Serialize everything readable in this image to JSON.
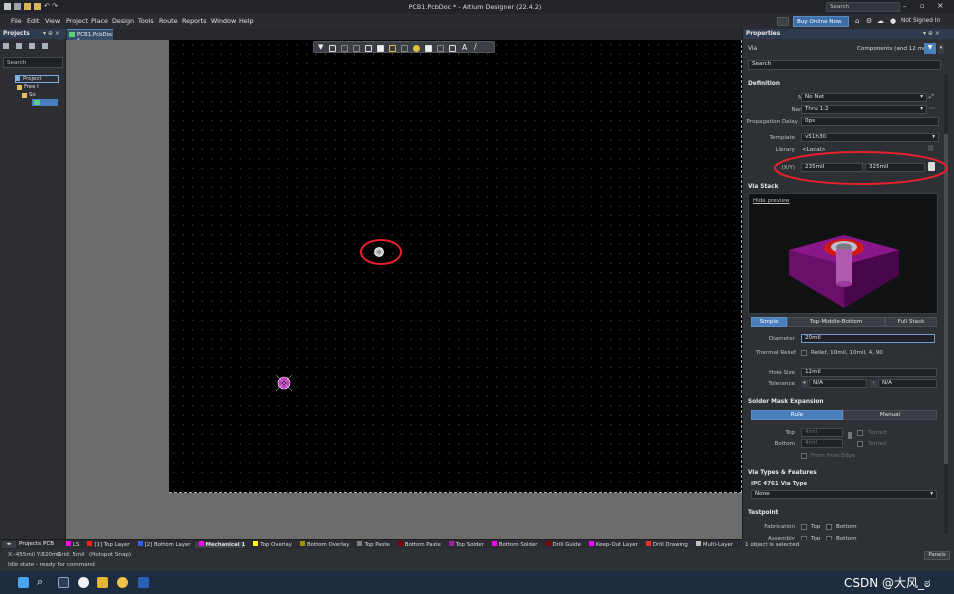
{
  "titlebar": {
    "title": "PCB1.PcbDoc * - Altium Designer (22.4.2)",
    "search_placeholder": "Search"
  },
  "menu": [
    "File",
    "Edit",
    "View",
    "Project",
    "Place",
    "Design",
    "Tools",
    "Route",
    "Reports",
    "Window",
    "Help"
  ],
  "toolbar_right": {
    "buy_label": "Buy Online Now",
    "signin_label": "Not Signed In"
  },
  "projects_panel": {
    "title": "Projects",
    "search_placeholder": "Search",
    "tree": [
      "Project",
      "Free I",
      "So"
    ]
  },
  "doc_tab": {
    "label": "PCB1.PcbDoc *"
  },
  "properties": {
    "title": "Properties",
    "object_label": "Via",
    "filter_label": "Components (and 12 more)",
    "search_placeholder": "Search",
    "definition": {
      "header": "Definition",
      "net_label": "Net",
      "net_value": "No Net",
      "name_label": "Name",
      "name_value": "Thru 1:2",
      "prop_delay_label": "Propagation Delay",
      "prop_delay_value": "0ps",
      "template_label": "Template",
      "template_value": "v51h30",
      "library_label": "Library",
      "library_value": "<Local>",
      "xy_label": "(X/Y)",
      "x_value": "235mil",
      "y_value": "325mil"
    },
    "via_stack": {
      "header": "Via Stack",
      "hide_preview": "Hide preview",
      "modes": [
        "Simple",
        "Top-Middle-Bottom",
        "Full Stack"
      ],
      "diameter_label": "Diameter",
      "diameter_value": "20mil",
      "thermal_label": "Thermal Relief",
      "thermal_value": "Relief, 10mil, 10mil, 4, 90",
      "hole_size_label": "Hole Size",
      "hole_size_value": "12mil",
      "tolerance_label": "Tolerance",
      "tol_plus": "N/A",
      "tol_minus": "N/A"
    },
    "solder_mask": {
      "header": "Solder Mask Expansion",
      "modes": [
        "Rule",
        "Manual"
      ],
      "top_label": "Top",
      "top_value": "4mil",
      "top_tented": "Tented",
      "bottom_label": "Bottom",
      "bottom_value": "4mil",
      "bottom_tented": "Tented",
      "from_hole_edge": "From Hole Edge"
    },
    "via_types": {
      "header": "Via Types & Features",
      "ipc_label": "IPC 4761 Via Type",
      "ipc_value": "None"
    },
    "testpoint": {
      "header": "Testpoint",
      "fabrication_label": "Fabrication",
      "assembly_label": "Assembly",
      "top_label": "Top",
      "bottom_label": "Bottom"
    },
    "selection_status": "1 object is selected"
  },
  "layers": [
    {
      "name": "LS",
      "color": "#ff00ff"
    },
    {
      "name": "[1] Top Layer",
      "color": "#ff2020"
    },
    {
      "name": "[2] Bottom Layer",
      "color": "#3060ff"
    },
    {
      "name": "Mechanical 1",
      "color": "#ff00ff"
    },
    {
      "name": "Top Overlay",
      "color": "#ffff00"
    },
    {
      "name": "Bottom Overlay",
      "color": "#a09000"
    },
    {
      "name": "Top Paste",
      "color": "#808080"
    },
    {
      "name": "Bottom Paste",
      "color": "#800000"
    },
    {
      "name": "Top Solder",
      "color": "#a020a0"
    },
    {
      "name": "Bottom Solder",
      "color": "#ff00ff"
    },
    {
      "name": "Drill Guide",
      "color": "#800000"
    },
    {
      "name": "Keep-Out Layer",
      "color": "#ff00ff"
    },
    {
      "name": "Drill Drawing",
      "color": "#ff2a2a"
    },
    {
      "name": "Multi-Layer",
      "color": "#c0c0c0"
    }
  ],
  "layerbar_tabs": [
    "Projects",
    "PCB"
  ],
  "status": {
    "coords": "X:-455mil Y:820mil",
    "grid": "Grid: 5mil",
    "snap": "(Hotspot Snap)",
    "state": "Idle state - ready for command",
    "panels_button": "Panels"
  },
  "watermark": "CSDN @大风_ಠ",
  "colors": {
    "accent": "#4a7fbd",
    "annotation": "#e8202a",
    "board": "#000000"
  }
}
